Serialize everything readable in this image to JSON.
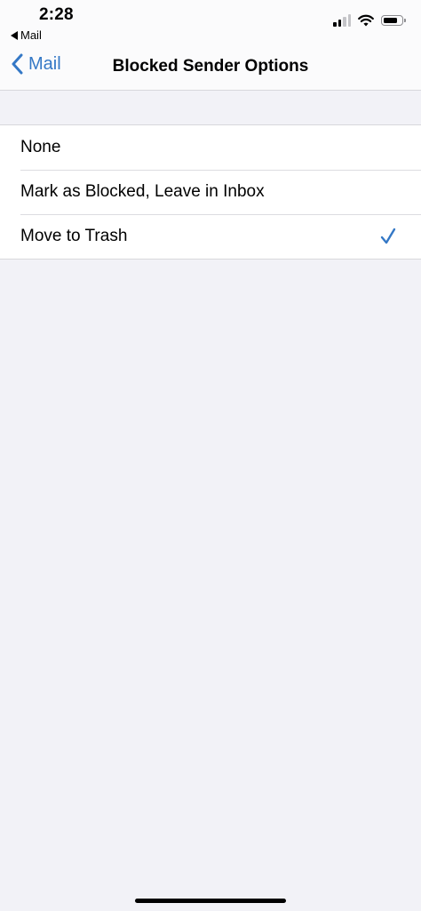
{
  "status_bar": {
    "time": "2:28",
    "back_app": "Mail"
  },
  "nav": {
    "back_label": "Mail",
    "title": "Blocked Sender Options"
  },
  "options": [
    {
      "label": "None",
      "selected": false
    },
    {
      "label": "Mark as Blocked, Leave in Inbox",
      "selected": false
    },
    {
      "label": "Move to Trash",
      "selected": true
    }
  ],
  "colors": {
    "accent": "#3478c6",
    "background": "#f2f2f7",
    "cell": "#ffffff",
    "separator": "#d8d8dc"
  },
  "icons": {
    "back": "chevron-left-icon",
    "selected": "checkmark-icon",
    "signal": "cellular-signal-icon",
    "wifi": "wifi-icon",
    "battery": "battery-icon"
  }
}
